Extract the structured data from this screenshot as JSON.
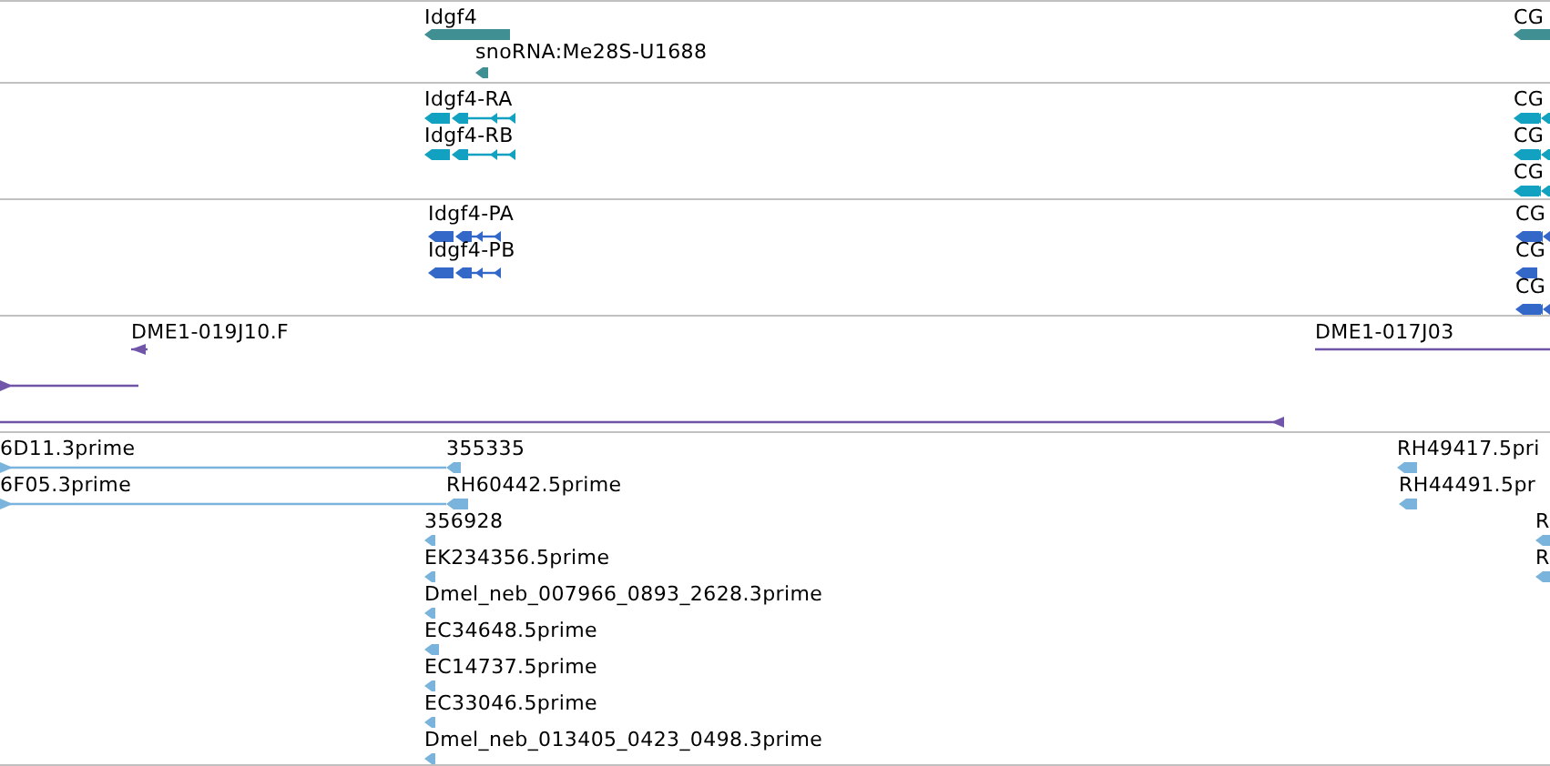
{
  "tracks": [
    {
      "color": "#3f8f93",
      "features": [
        {
          "label": "Idgf4",
          "kind": "gene",
          "forward": false
        },
        {
          "label": "snoRNA:Me28S-U1688",
          "kind": "gene",
          "forward": false
        },
        {
          "label": "CG",
          "kind": "gene",
          "forward": false
        }
      ]
    },
    {
      "color": "#12a1c0",
      "features": [
        {
          "label": "Idgf4-RA",
          "kind": "transcript",
          "forward": false
        },
        {
          "label": "Idgf4-RB",
          "kind": "transcript",
          "forward": false
        },
        {
          "label": "CG",
          "kind": "transcript",
          "forward": false
        },
        {
          "label": "CG",
          "kind": "transcript",
          "forward": false
        },
        {
          "label": "CG",
          "kind": "transcript",
          "forward": false
        }
      ]
    },
    {
      "color": "#3368c9",
      "features": [
        {
          "label": "Idgf4-PA",
          "kind": "transcript",
          "forward": false
        },
        {
          "label": "Idgf4-PB",
          "kind": "transcript",
          "forward": false
        },
        {
          "label": "CG",
          "kind": "transcript",
          "forward": false
        },
        {
          "label": "CG",
          "kind": "transcript",
          "forward": false
        },
        {
          "label": "CG",
          "kind": "transcript",
          "forward": false
        }
      ]
    },
    {
      "color": "#7155a9",
      "features": [
        {
          "label": "DME1-019J10.F",
          "kind": "clone",
          "forward": false
        },
        {
          "kind": "span",
          "forward": true
        },
        {
          "label": "DME1-017J03",
          "kind": "clone",
          "forward": true
        },
        {
          "kind": "span",
          "forward": false
        }
      ]
    },
    {
      "color": "#7ab3dc",
      "features": [
        {
          "label": "6D11.3prime",
          "kind": "span",
          "forward": true
        },
        {
          "label": "355335",
          "kind": "read",
          "forward": false
        },
        {
          "label": "6F05.3prime",
          "kind": "span",
          "forward": true
        },
        {
          "label": "RH60442.5prime",
          "kind": "read",
          "forward": false
        },
        {
          "label": "356928",
          "kind": "read",
          "forward": false
        },
        {
          "label": "EK234356.5prime",
          "kind": "read",
          "forward": false
        },
        {
          "label": "Dmel_neb_007966_0893_2628.3prime",
          "kind": "read",
          "forward": false
        },
        {
          "label": "EC34648.5prime",
          "kind": "read",
          "forward": false
        },
        {
          "label": "EC14737.5prime",
          "kind": "read",
          "forward": false
        },
        {
          "label": "EC33046.5prime",
          "kind": "read",
          "forward": false
        },
        {
          "label": "Dmel_neb_013405_0423_0498.3prime",
          "kind": "read",
          "forward": false
        },
        {
          "label": "RH49417.5pri",
          "kind": "read",
          "forward": false
        },
        {
          "label": "RH44491.5pr",
          "kind": "read",
          "forward": false
        },
        {
          "label": "R",
          "kind": "read",
          "forward": false
        },
        {
          "label": "R",
          "kind": "read",
          "forward": false
        }
      ]
    }
  ]
}
